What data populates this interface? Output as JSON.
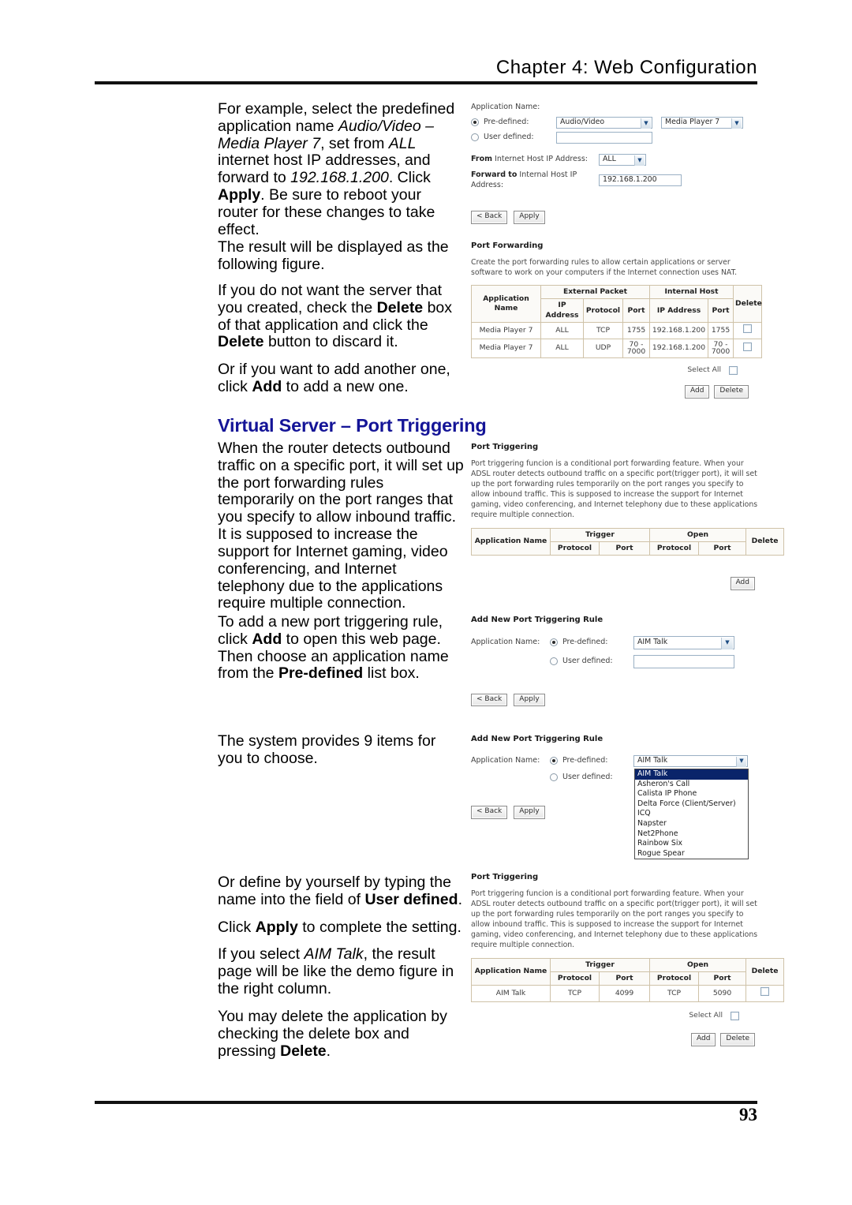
{
  "header": {
    "chapter_title": "Chapter 4: Web Configuration"
  },
  "footer": {
    "page_number": "93"
  },
  "section": {
    "heading": "Virtual Server – Port Triggering",
    "heading_color": "#141497"
  },
  "body_text": {
    "p1_a": "For example, select the predefined application name ",
    "p1_b": "Audio/Video – Media Player 7",
    "p1_c": ", set from ",
    "p1_d": "ALL",
    "p1_e": " internet host IP addresses, and forward to ",
    "p1_f": "192.168.1.200",
    "p1_g": ". Click ",
    "p1_h": "Apply",
    "p1_i": ". Be sure to reboot your router for these changes to take effect.",
    "p2": "The result will be displayed as the following figure.",
    "p3_a": "If you do not want the server that you created, check the ",
    "p3_b": "Delete",
    "p3_c": " box of that application and click the ",
    "p3_d": "Delete",
    "p3_e": " button to discard it.",
    "p4_a": "Or if you want to add another one, click ",
    "p4_b": "Add",
    "p4_c": " to add a new one.",
    "p5": "When the router detects outbound traffic on a specific port, it will set up the port forwarding rules temporarily on the port ranges that you specify to allow inbound traffic. It is supposed to increase the support for Internet gaming, video conferencing, and Internet telephony due to the applications require multiple connection.",
    "p6_a": "To add a new port triggering rule, click ",
    "p6_b": "Add",
    "p6_c": " to open this web page. Then choose an application name from the ",
    "p6_d": "Pre-defined",
    "p6_e": " list box.",
    "p7": "The system provides 9 items for you to choose.",
    "p8_a": "Or define by yourself by typing the name into the field of ",
    "p8_b": "User defined",
    "p8_c": ".",
    "p9_a": "Click ",
    "p9_b": "Apply",
    "p9_c": " to complete the setting.",
    "p10_a": "If you select ",
    "p10_b": "AIM Talk",
    "p10_c": ", the result page will be like the demo figure in the right column.",
    "p11_a": "You may delete the application by checking the delete box and pressing ",
    "p11_b": "Delete",
    "p11_c": "."
  },
  "figure_virtual_server_form": {
    "application_name_label": "Application Name:",
    "predefined_label": "Pre-defined:",
    "user_defined_label": "User defined:",
    "predefined_category_value": "Audio/Video",
    "predefined_app_value": "Media Player 7",
    "user_defined_value": "",
    "from_label_bold": "From",
    "from_label_rest": " Internet Host IP Address:",
    "from_value": "ALL",
    "forward_label_bold": "Forward to",
    "forward_label_rest": " Internal Host IP Address:",
    "forward_value": "192.168.1.200",
    "back_button": "< Back",
    "apply_button": "Apply"
  },
  "figure_port_forwarding": {
    "title": "Port Forwarding",
    "description": "Create the port forwarding rules to allow certain applications or server software to work on your computers if the Internet connection uses NAT.",
    "group_headers": {
      "application_name": "Application Name",
      "external_packet": "External Packet",
      "internal_host": "Internal Host",
      "delete": "Delete"
    },
    "sub_headers": {
      "ext_ip": "IP Address",
      "ext_protocol": "Protocol",
      "ext_port": "Port",
      "int_ip": "IP Address",
      "int_port": "Port"
    },
    "rows": [
      {
        "application_name": "Media Player 7",
        "ext_ip": "ALL",
        "ext_protocol": "TCP",
        "ext_port": "1755",
        "int_ip": "192.168.1.200",
        "int_port": "1755"
      },
      {
        "application_name": "Media Player 7",
        "ext_ip": "ALL",
        "ext_protocol": "UDP",
        "ext_port": "70 - 7000",
        "int_ip": "192.168.1.200",
        "int_port": "70 - 7000"
      }
    ],
    "select_all_label": "Select All",
    "add_button": "Add",
    "delete_button": "Delete"
  },
  "figure_port_triggering_empty": {
    "title": "Port Triggering",
    "description": "Port triggering funcion is a conditional port forwarding feature. When your ADSL router detects outbound traffic on a specific port(trigger port), it will set up the port forwarding rules temporarily on the port ranges you specify to allow inbound traffic. This is supposed to increase the support for Internet gaming, video conferencing, and Internet telephony due to these applications require multiple connection.",
    "group_headers": {
      "application_name": "Application Name",
      "trigger": "Trigger",
      "open": "Open",
      "delete": "Delete"
    },
    "sub_headers": {
      "trigger_protocol": "Protocol",
      "trigger_port": "Port",
      "open_protocol": "Protocol",
      "open_port": "Port"
    },
    "add_button": "Add"
  },
  "figure_add_rule_closed": {
    "title": "Add New Port Triggering Rule",
    "application_name_label": "Application Name:",
    "predefined_label": "Pre-defined:",
    "user_defined_label": "User defined:",
    "predefined_value": "AIM Talk",
    "user_defined_value": "",
    "back_button": "< Back",
    "apply_button": "Apply"
  },
  "figure_add_rule_open": {
    "title": "Add New Port Triggering Rule",
    "application_name_label": "Application Name:",
    "predefined_label": "Pre-defined:",
    "user_defined_label": "User defined:",
    "predefined_value": "AIM Talk",
    "options": [
      "AIM Talk",
      "Asheron's Call",
      "Calista IP Phone",
      "Delta Force (Client/Server)",
      "ICQ",
      "Napster",
      "Net2Phone",
      "Rainbow Six",
      "Rogue Spear"
    ],
    "selected_option": "AIM Talk",
    "back_button": "< Back",
    "apply_button": "Apply"
  },
  "figure_port_triggering_result": {
    "title": "Port Triggering",
    "description": "Port triggering funcion is a conditional port forwarding feature. When your ADSL router detects outbound traffic on a specific port(trigger port), it will set up the port forwarding rules temporarily on the port ranges you specify to allow inbound traffic. This is supposed to increase the support for Internet gaming, video conferencing, and Internet telephony due to these applications require multiple connection.",
    "group_headers": {
      "application_name": "Application Name",
      "trigger": "Trigger",
      "open": "Open",
      "delete": "Delete"
    },
    "sub_headers": {
      "trigger_protocol": "Protocol",
      "trigger_port": "Port",
      "open_protocol": "Protocol",
      "open_port": "Port"
    },
    "rows": [
      {
        "application_name": "AIM Talk",
        "trigger_protocol": "TCP",
        "trigger_port": "4099",
        "open_protocol": "TCP",
        "open_port": "5090"
      }
    ],
    "select_all_label": "Select All",
    "add_button": "Add",
    "delete_button": "Delete"
  }
}
